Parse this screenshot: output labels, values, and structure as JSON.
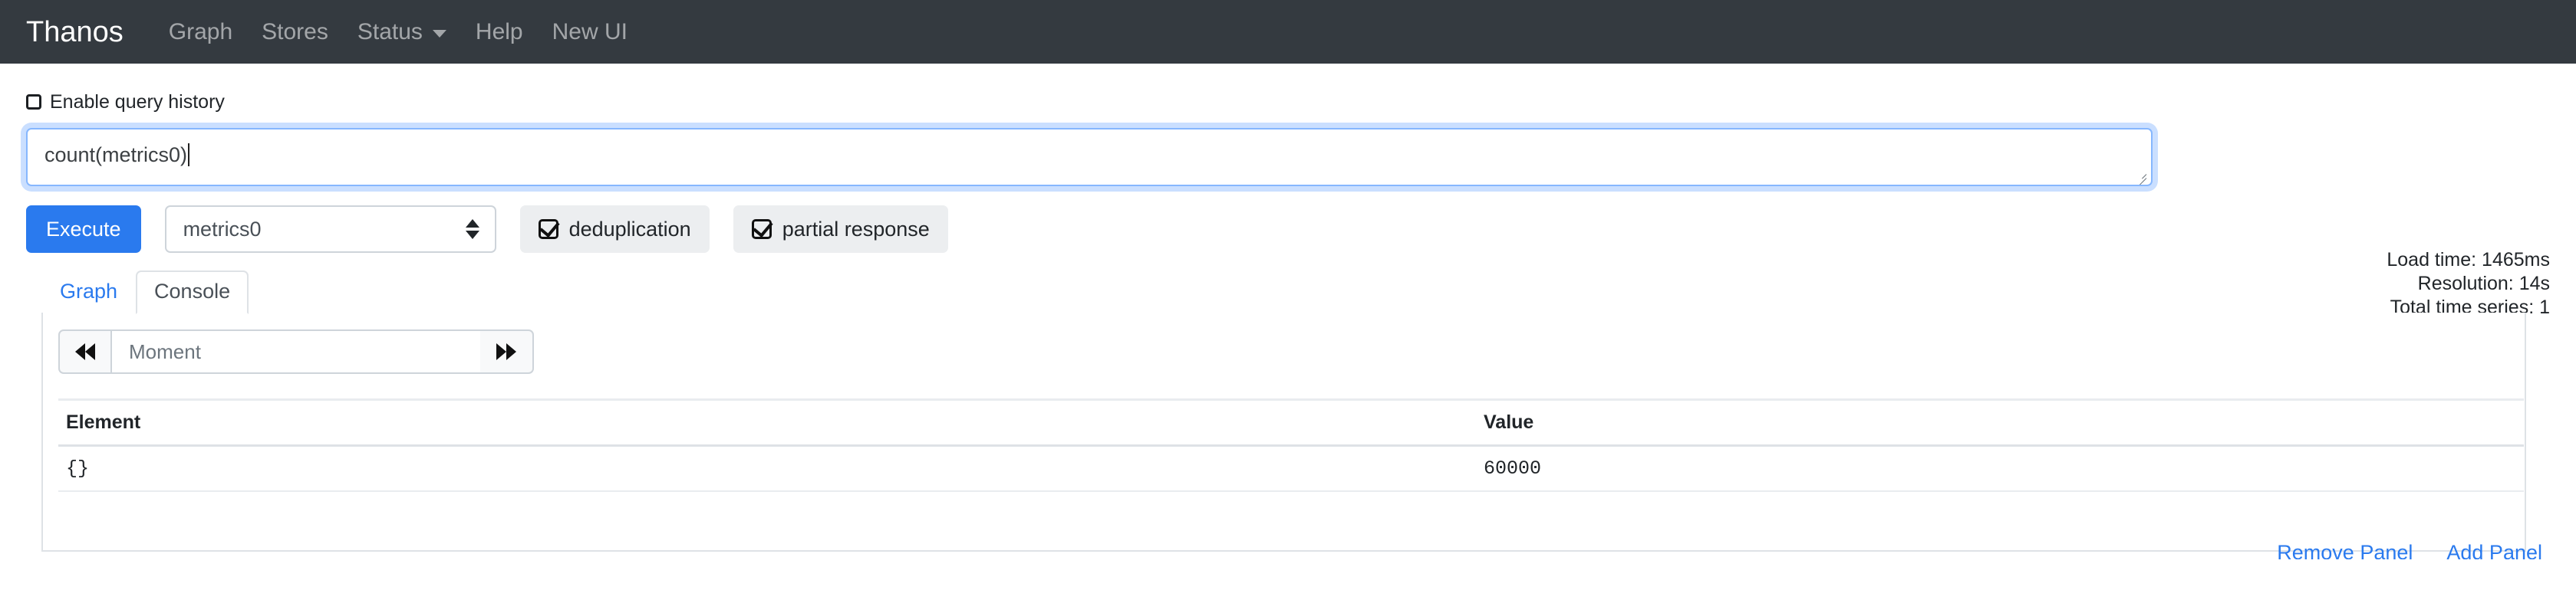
{
  "navbar": {
    "brand": "Thanos",
    "items": [
      {
        "label": "Graph"
      },
      {
        "label": "Stores"
      },
      {
        "label": "Status"
      },
      {
        "label": "Help"
      },
      {
        "label": "New UI"
      }
    ]
  },
  "query_history": {
    "label": "Enable query history",
    "checked": false
  },
  "query": {
    "value": "count(metrics0)",
    "placeholder": "Expression (press Shift+Enter for newlines)"
  },
  "stats": {
    "load_time": "Load time: 1465ms",
    "resolution": "Resolution: 14s",
    "total_time_series": "Total time series: 1"
  },
  "controls": {
    "execute_label": "Execute",
    "metric_select_value": "metrics0",
    "deduplication_label": "deduplication",
    "partial_response_label": "partial response"
  },
  "tabs": [
    {
      "label": "Graph",
      "active": false
    },
    {
      "label": "Console",
      "active": true
    }
  ],
  "console": {
    "moment_placeholder": "Moment",
    "moment_value": "",
    "table": {
      "columns": [
        "Element",
        "Value"
      ],
      "rows": [
        {
          "element": "{}",
          "value": "60000"
        }
      ]
    }
  },
  "footer_links": [
    {
      "label": "Remove Panel"
    },
    {
      "label": "Add Panel"
    }
  ],
  "colors": {
    "navbar_bg": "#343a40",
    "accent": "#2a7aee",
    "focus_ring": "#86b7fe",
    "border": "#dee2e6",
    "muted_text": "#6c757d"
  }
}
